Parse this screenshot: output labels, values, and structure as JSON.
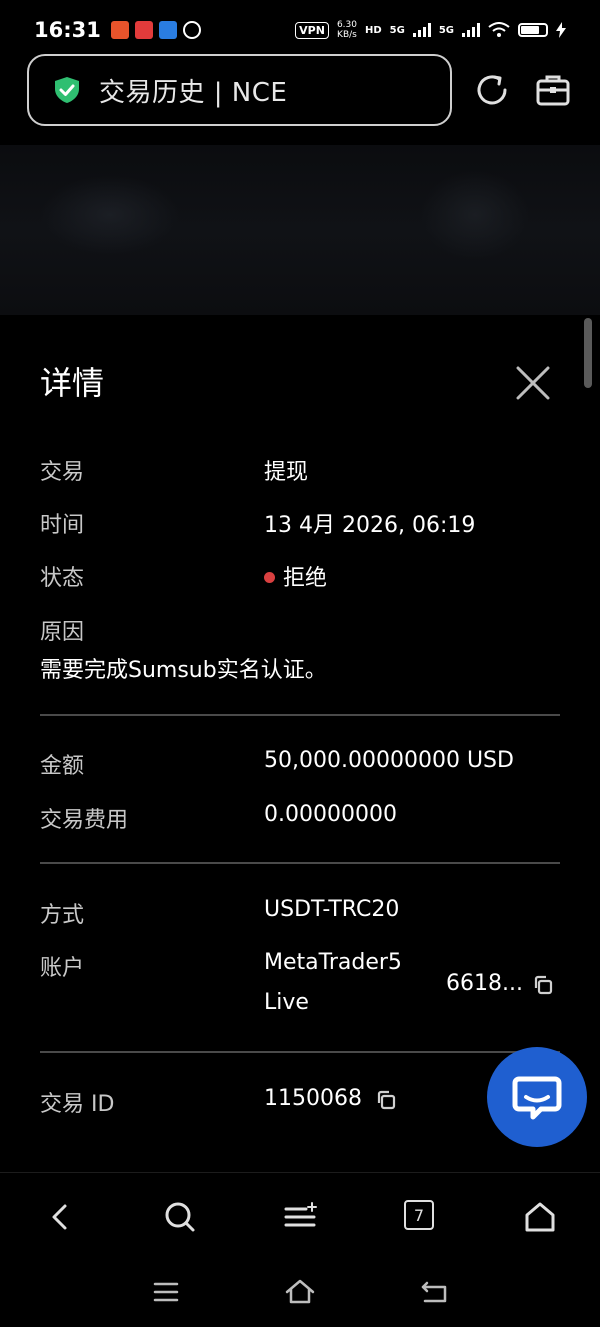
{
  "status_bar": {
    "time": "16:31",
    "vpn": "VPN",
    "speed_value": "6.30",
    "speed_unit": "KB/s",
    "hd": "HD",
    "net1": "5G",
    "net2": "5G"
  },
  "browser": {
    "page_title": "交易历史 | NCE"
  },
  "sheet": {
    "title": "详情",
    "rows": [
      {
        "label": "交易",
        "value": "提现"
      },
      {
        "label": "时间",
        "value": "13 4月 2026, 06:19"
      },
      {
        "label": "状态",
        "value": "拒绝"
      },
      {
        "label": "原因",
        "value": "需要完成Sumsub实名认证。"
      },
      {
        "label": "金额",
        "value": "50,000.00000000 USD"
      },
      {
        "label": "交易费用",
        "value": "0.00000000"
      },
      {
        "label": "方式",
        "value": "USDT-TRC20"
      },
      {
        "label": "账户",
        "value": "MetaTrader5",
        "value_line2": "Live",
        "account_number": "6618..."
      },
      {
        "label": "交易 ID",
        "value": "1150068"
      }
    ]
  },
  "colors": {
    "status_rejected": "#d94040",
    "shield_green": "#2fbf71",
    "chat_blue": "#1f5fd0"
  },
  "toolbar": {
    "tabs_count": "7"
  }
}
